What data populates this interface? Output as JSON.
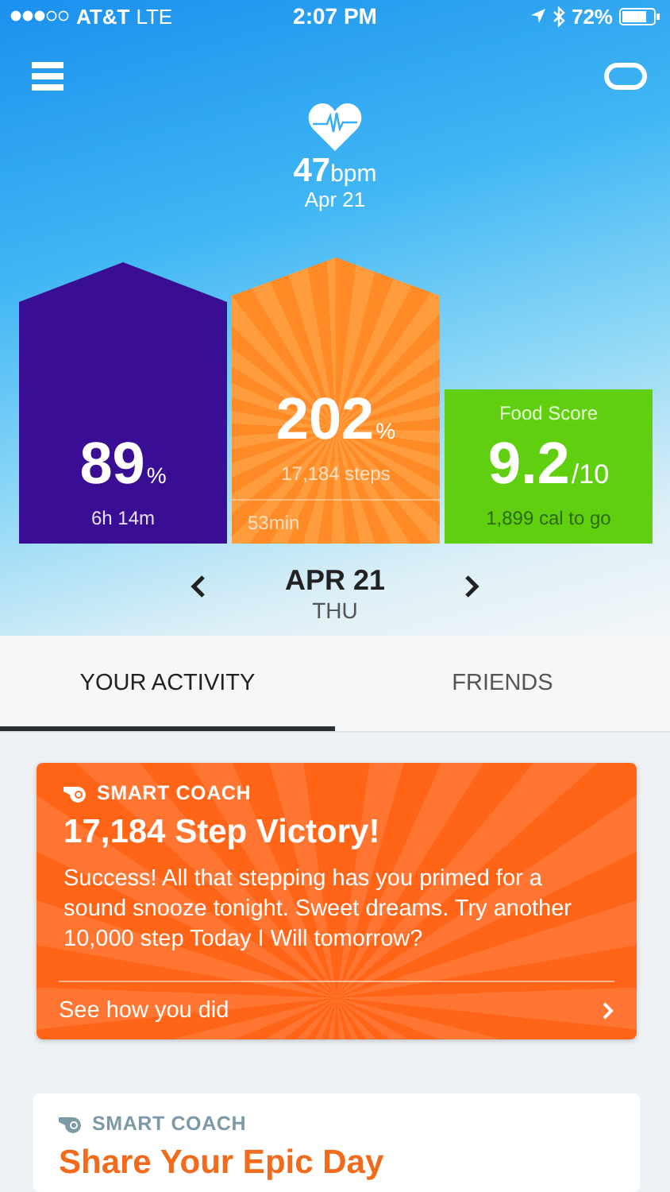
{
  "status_bar": {
    "carrier": "AT&T",
    "network": "LTE",
    "time": "2:07 PM",
    "battery": "72%"
  },
  "heart_rate": {
    "value": "47",
    "unit": "bpm",
    "date": "Apr 21"
  },
  "metrics": [
    {
      "kind": "sleep",
      "value": "89",
      "unit": "%",
      "detail": "6h 14m"
    },
    {
      "kind": "steps",
      "value": "202",
      "unit": "%",
      "detail": "17,184 steps",
      "footer": "53min"
    },
    {
      "kind": "food",
      "label": "Food Score",
      "value": "9.2",
      "unit": "/10",
      "detail": "1,899 cal to go"
    }
  ],
  "date_nav": {
    "date": "APR 21",
    "weekday": "THU"
  },
  "tabs": [
    {
      "label": "YOUR ACTIVITY",
      "selected": true
    },
    {
      "label": "FRIENDS",
      "selected": false
    }
  ],
  "cards": [
    {
      "kind": "highlight",
      "tag": "SMART COACH",
      "title": "17,184 Step Victory!",
      "body": "Success! All that stepping has you primed for a sound snooze tonight. Sweet dreams. Try another 10,000 step Today I Will tomorrow?",
      "link": "See how you did"
    },
    {
      "kind": "plain",
      "tag": "SMART COACH",
      "title": "Share Your Epic Day"
    }
  ]
}
